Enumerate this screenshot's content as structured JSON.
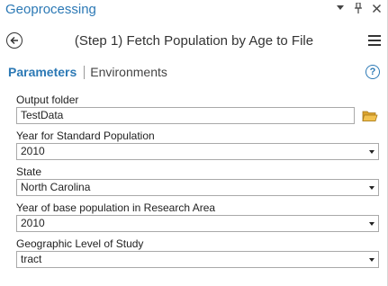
{
  "pane": {
    "title": "Geoprocessing",
    "controls": {
      "menu_icon": "chevron-down-icon",
      "pin_icon": "pin-icon",
      "close_icon": "close-icon"
    }
  },
  "tool": {
    "title": "(Step 1) Fetch Population by Age to File",
    "back_icon": "back-arrow-icon",
    "menu_icon": "hamburger-menu-icon"
  },
  "tabs": [
    {
      "label": "Parameters",
      "active": true
    },
    {
      "label": "Environments",
      "active": false
    }
  ],
  "help_label": "?",
  "parameters": {
    "output_folder": {
      "label": "Output folder",
      "value": "TestData"
    },
    "standard_year": {
      "label": "Year for Standard Population",
      "value": "2010"
    },
    "state": {
      "label": "State",
      "value": "North Carolina"
    },
    "research_year": {
      "label": "Year of base population in Research Area",
      "value": "2010"
    },
    "geo_level": {
      "label": "Geographic Level of Study",
      "value": "tract"
    }
  },
  "colors": {
    "accent": "#2c79b5",
    "folder": "#e8b33a"
  }
}
